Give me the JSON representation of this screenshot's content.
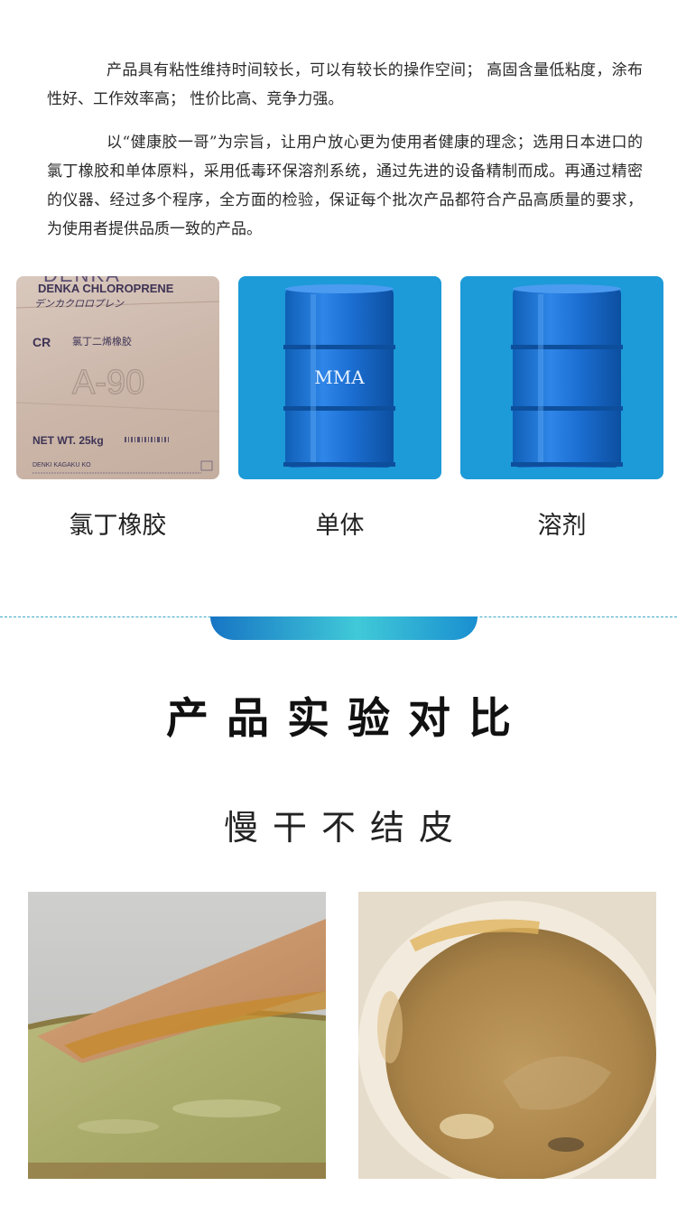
{
  "intro": {
    "para1": "产品具有粘性维持时间较长，可以有较长的操作空间； 高固含量低粘度，涂布性好、工作效率高； 性价比高、竞争力强。",
    "para2": "以“健康胶一哥”为宗旨，让用户放心更为使用者健康的理念；选用日本进口的氯丁橡胶和单体原料，采用低毒环保溶剂系统，通过先进的设备精制而成。再通过精密的仪器、经过多个程序，全方面的检验，保证每个批次产品都符合产品高质量的要求，为使用者提供品质一致的产品。"
  },
  "materials": {
    "bag": {
      "brand_top": "DENKA",
      "brand_line": "DENKA CHLOROPRENE",
      "katakana": "デンカクロロプレン",
      "cr_label": "CR",
      "cn_label": "氯丁二烯橡胶",
      "grade": "A-90",
      "net_weight": "NET WT. 25kg",
      "maker": "DENKI KAGAKU KO",
      "caption": "氯丁橡胶"
    },
    "monomer": {
      "drum_label": "MMA",
      "caption": "单体"
    },
    "solvent": {
      "caption": "溶剂"
    }
  },
  "section": {
    "title": "产品实验对比",
    "subtitle": "慢干不结皮"
  },
  "colors": {
    "accent_blue": "#1d9ad8",
    "divider_gradient_start": "#1775c4",
    "divider_gradient_mid": "#40c9d8"
  }
}
